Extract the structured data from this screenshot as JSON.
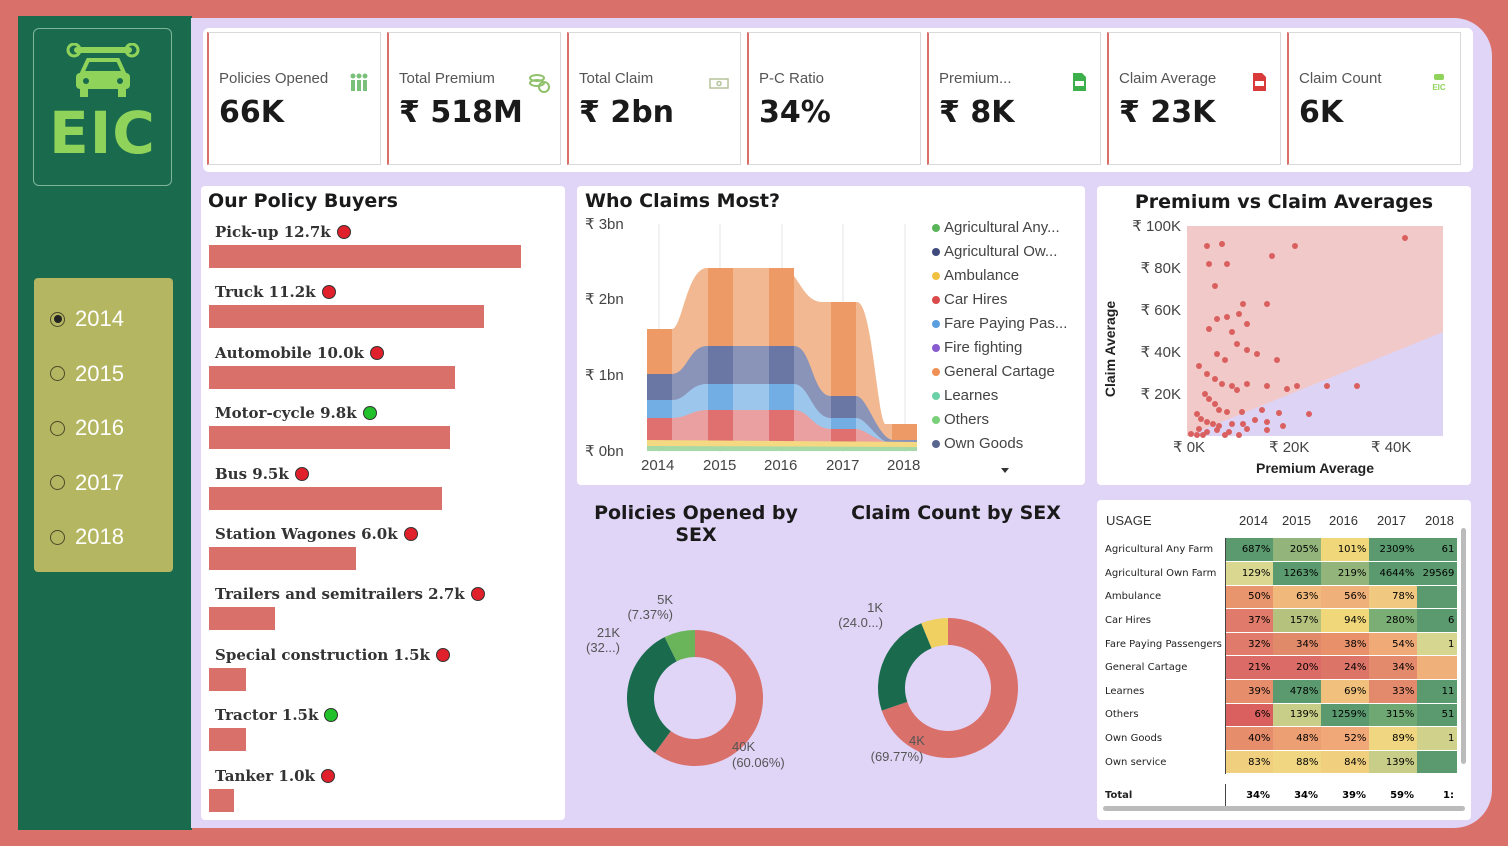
{
  "logo": {
    "text": "EIC",
    "icon": "car-wrench-icon"
  },
  "years": [
    {
      "label": "2014",
      "selected": true
    },
    {
      "label": "2015",
      "selected": false
    },
    {
      "label": "2016",
      "selected": false
    },
    {
      "label": "2017",
      "selected": false
    },
    {
      "label": "2018",
      "selected": false
    }
  ],
  "kpis": [
    {
      "label": "Policies Opened",
      "value": "66K",
      "icon": "people-icon"
    },
    {
      "label": "Total Premium",
      "value": "₹ 518M",
      "icon": "coins-icon"
    },
    {
      "label": "Total Claim",
      "value": "₹ 2bn",
      "icon": "cash-icon"
    },
    {
      "label": "P-C Ratio",
      "value": "34%",
      "icon": ""
    },
    {
      "label": "Premium...",
      "value": "₹ 8K",
      "icon": "document-money-icon"
    },
    {
      "label": "Claim Average",
      "value": "₹ 23K",
      "icon": "document-money-red-icon"
    },
    {
      "label": "Claim Count",
      "value": "6K",
      "icon": "eic-car-icon"
    }
  ],
  "buyers": {
    "title": "Our Policy Buyers",
    "items": [
      {
        "label": "Pick-up 12.7k",
        "value": 12.7,
        "status": "red"
      },
      {
        "label": "Truck 11.2k",
        "value": 11.2,
        "status": "red"
      },
      {
        "label": "Automobile 10.0k",
        "value": 10.0,
        "status": "red"
      },
      {
        "label": "Motor-cycle 9.8k",
        "value": 9.8,
        "status": "green"
      },
      {
        "label": "Bus 9.5k",
        "value": 9.5,
        "status": "red"
      },
      {
        "label": "Station Wagones 6.0k",
        "value": 6.0,
        "status": "red"
      },
      {
        "label": "Trailers and semitrailers 2.7k",
        "value": 2.7,
        "status": "red"
      },
      {
        "label": "Special construction 1.5k",
        "value": 1.5,
        "status": "red"
      },
      {
        "label": "Tractor 1.5k",
        "value": 1.5,
        "status": "green"
      },
      {
        "label": "Tanker 1.0k",
        "value": 1.0,
        "status": "red"
      }
    ],
    "colors": {
      "bar": "#d9706a",
      "red": "#e0202a",
      "green": "#22c02a"
    }
  },
  "claims_chart": {
    "title": "Who Claims Most?",
    "y_ticks": [
      "₹ 3bn",
      "₹ 2bn",
      "₹ 1bn",
      "₹ 0bn"
    ],
    "x_ticks": [
      "2014",
      "2015",
      "2016",
      "2017",
      "2018"
    ],
    "legend": [
      {
        "label": "Agricultural Any...",
        "color": "#5ab55a"
      },
      {
        "label": "Agricultural Ow...",
        "color": "#3d4a7a"
      },
      {
        "label": "Ambulance",
        "color": "#f0c040"
      },
      {
        "label": "Car Hires",
        "color": "#d94a4a"
      },
      {
        "label": "Fare Paying Pas...",
        "color": "#5a9ee0"
      },
      {
        "label": "Fire fighting",
        "color": "#8a5ad0"
      },
      {
        "label": "General Cartage",
        "color": "#ef9155"
      },
      {
        "label": "Learnes",
        "color": "#6ad0a8"
      },
      {
        "label": "Others",
        "color": "#7ad07a"
      },
      {
        "label": "Own Goods",
        "color": "#5a6590"
      }
    ]
  },
  "scatter": {
    "title": "Premium vs Claim Averages",
    "y_ticks": [
      "₹ 100K",
      "₹ 80K",
      "₹ 60K",
      "₹ 40K",
      "₹ 20K"
    ],
    "x_ticks": [
      "₹ 0K",
      "₹ 20K",
      "₹ 40K"
    ],
    "xlabel": "Premium Average",
    "ylabel": "Claim Average"
  },
  "donut_policies": {
    "title": "Policies Opened by SEX",
    "slices": [
      {
        "label": "40K",
        "pct": "(60.06%)",
        "value": 60.06,
        "color": "#d9706a"
      },
      {
        "label": "21K",
        "pct": "(32...)",
        "value": 32.57,
        "color": "#1a6b4e"
      },
      {
        "label": "5K",
        "pct": "(7.37%)",
        "value": 7.37,
        "color": "#6ab55a"
      }
    ]
  },
  "donut_claims": {
    "title": "Claim Count by SEX",
    "slices": [
      {
        "label": "4K",
        "pct": "(69.77%)",
        "value": 69.77,
        "color": "#d9706a"
      },
      {
        "label": "1K",
        "pct": "(24.0...)",
        "value": 24.0,
        "color": "#1a6b4e"
      },
      {
        "label": "",
        "pct": "",
        "value": 6.23,
        "color": "#f0d060"
      }
    ]
  },
  "usage_table": {
    "header": [
      "USAGE",
      "2014",
      "2015",
      "2016",
      "2017",
      "2018"
    ],
    "rows": [
      {
        "label": "Agricultural Any Farm",
        "cells": [
          "687%",
          "205%",
          "101%",
          "2309%",
          "61"
        ],
        "colors": [
          "#5a9a6e",
          "#93b57c",
          "#f0d87a",
          "#5a9a6e",
          "#5a9a6e"
        ]
      },
      {
        "label": "Agricultural Own Farm",
        "cells": [
          "129%",
          "1263%",
          "219%",
          "4644%",
          "29569"
        ],
        "colors": [
          "#d9d790",
          "#5a9a6e",
          "#93b57c",
          "#5a9a6e",
          "#5a9a6e"
        ]
      },
      {
        "label": "Ambulance",
        "cells": [
          "50%",
          "63%",
          "56%",
          "78%",
          ""
        ],
        "colors": [
          "#e8956e",
          "#f0b87a",
          "#f0b07a",
          "#f0c880",
          "#5a9a6e"
        ]
      },
      {
        "label": "Car Hires",
        "cells": [
          "37%",
          "157%",
          "94%",
          "280%",
          "6"
        ],
        "colors": [
          "#e07a6a",
          "#b5c27e",
          "#f0d87a",
          "#7aae74",
          "#5a9a6e"
        ]
      },
      {
        "label": "Fare Paying Passengers",
        "cells": [
          "32%",
          "34%",
          "38%",
          "54%",
          "1"
        ],
        "colors": [
          "#e07a6a",
          "#e08a6a",
          "#e8906a",
          "#f0aa78",
          "#d6d690"
        ]
      },
      {
        "label": "General Cartage",
        "cells": [
          "21%",
          "20%",
          "24%",
          "34%",
          ""
        ],
        "colors": [
          "#db6b66",
          "#db6b66",
          "#dd7468",
          "#e48a6c",
          "#f0b07a"
        ]
      },
      {
        "label": "Learnes",
        "cells": [
          "39%",
          "478%",
          "69%",
          "33%",
          "11"
        ],
        "colors": [
          "#e68d6c",
          "#5a9a6e",
          "#f0c07c",
          "#e48a6c",
          "#5a9a6e"
        ]
      },
      {
        "label": "Others",
        "cells": [
          "6%",
          "139%",
          "1259%",
          "315%",
          "51"
        ],
        "colors": [
          "#d9605e",
          "#c8cd88",
          "#5a9a6e",
          "#6fa872",
          "#5a9a6e"
        ]
      },
      {
        "label": "Own Goods",
        "cells": [
          "40%",
          "48%",
          "52%",
          "89%",
          "1"
        ],
        "colors": [
          "#e68d6c",
          "#ec9f72",
          "#f0a878",
          "#f0d680",
          "#d0d28c"
        ]
      },
      {
        "label": "Own service",
        "cells": [
          "83%",
          "88%",
          "84%",
          "139%",
          ""
        ],
        "colors": [
          "#f0cf7e",
          "#f0d680",
          "#f0d07e",
          "#c8cd88",
          "#5a9a6e"
        ]
      }
    ],
    "total": {
      "label": "Total",
      "cells": [
        "34%",
        "34%",
        "39%",
        "59%",
        "1:"
      ]
    }
  }
}
